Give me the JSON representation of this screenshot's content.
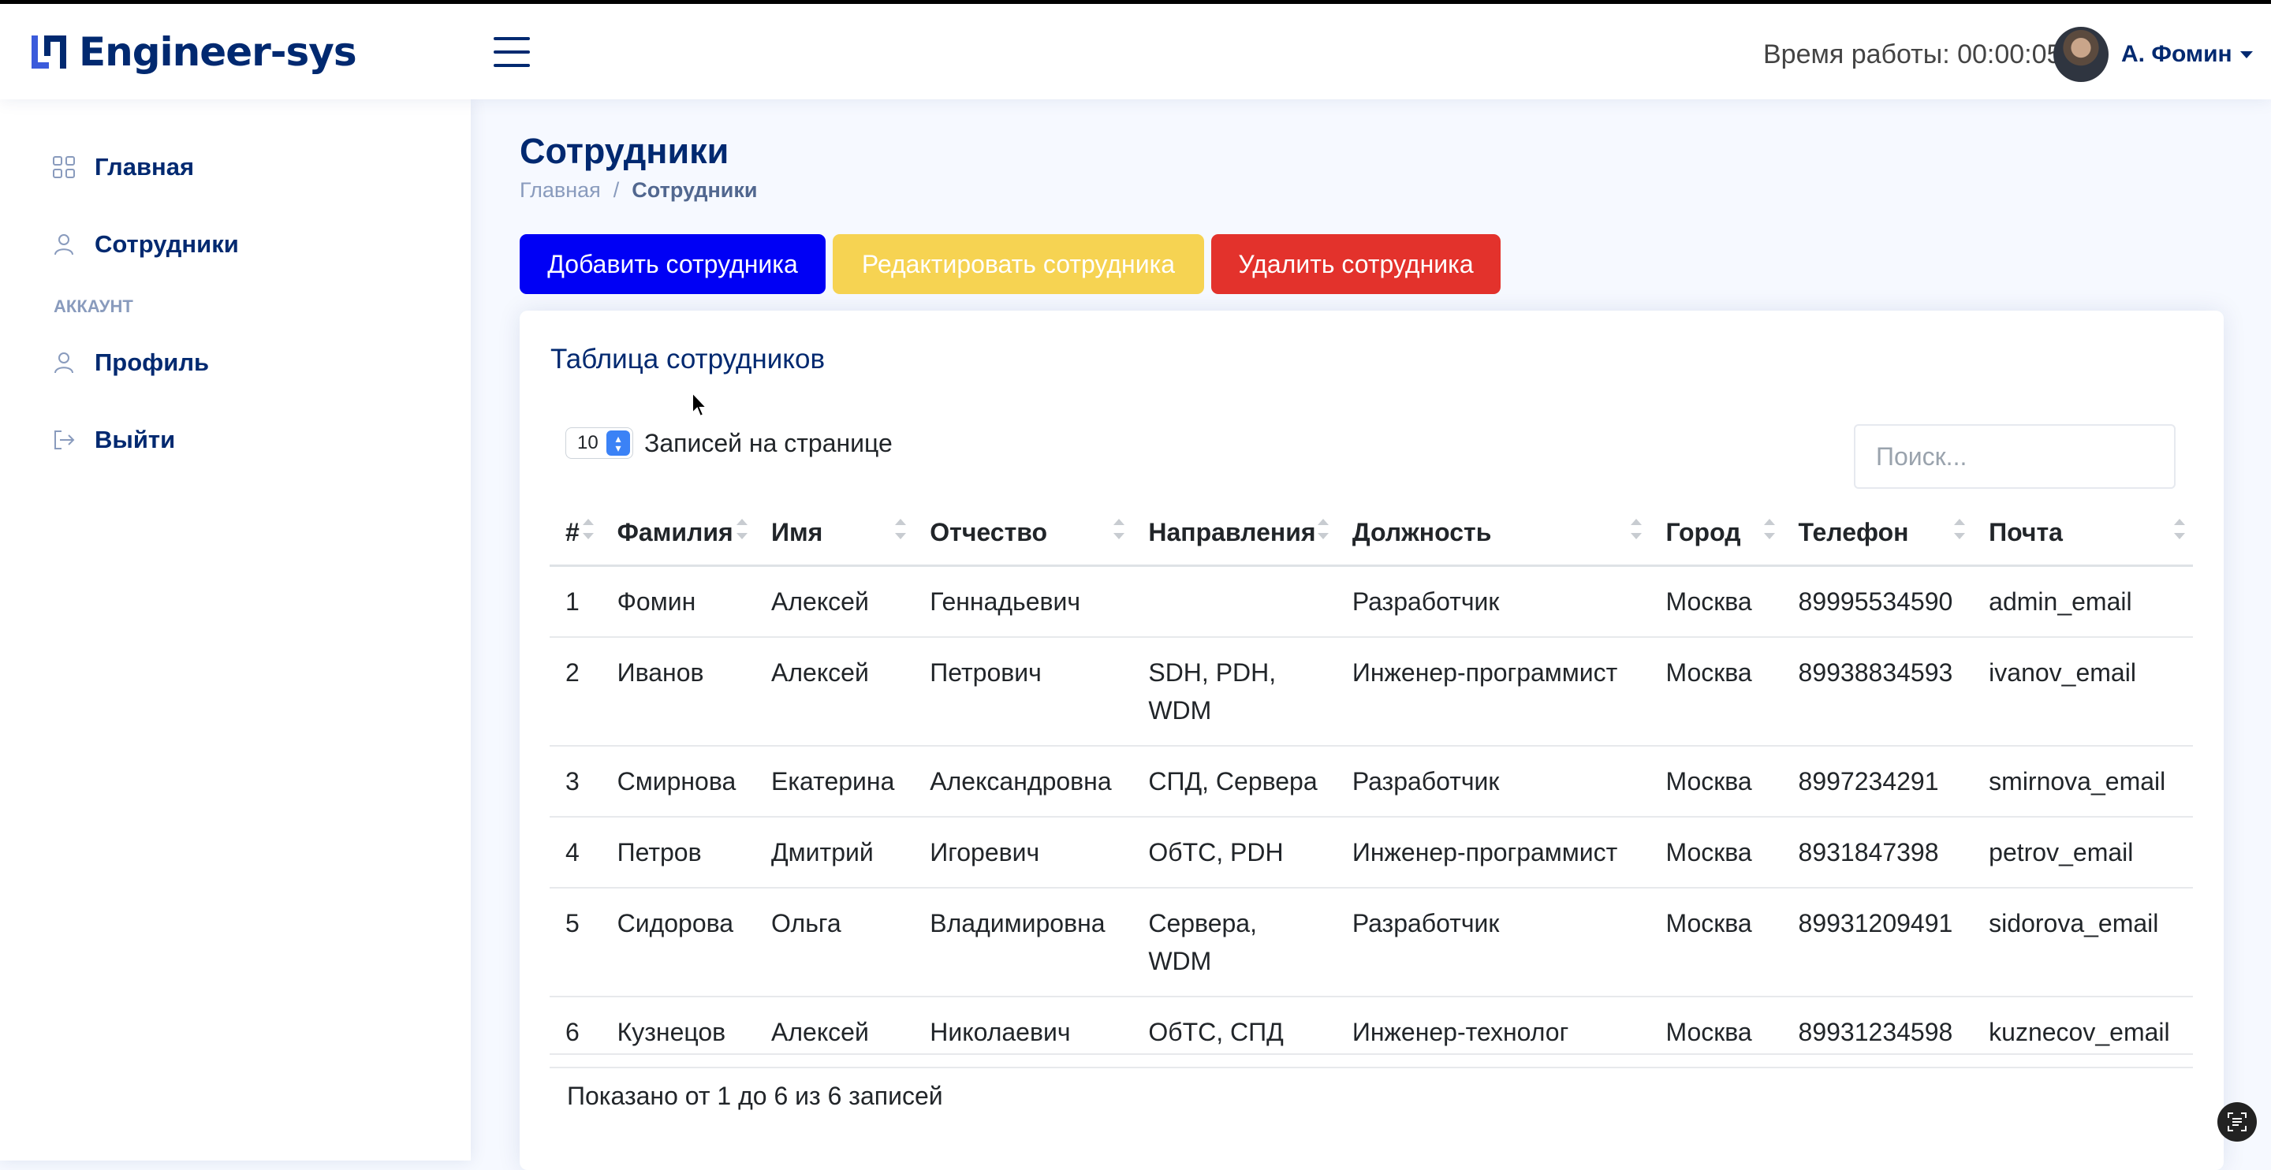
{
  "app": {
    "name": "Engineer-sys"
  },
  "header": {
    "uptime": "Время работы: 00:00:05",
    "user_name": "А. Фомин"
  },
  "sidebar": {
    "items": [
      {
        "label": "Главная",
        "icon": "grid-icon"
      },
      {
        "label": "Сотрудники",
        "icon": "person-icon"
      }
    ],
    "heading": "АККАУНТ",
    "account_items": [
      {
        "label": "Профиль",
        "icon": "person-icon"
      },
      {
        "label": "Выйти",
        "icon": "logout-icon"
      }
    ]
  },
  "page": {
    "title": "Сотрудники",
    "breadcrumb": [
      "Главная",
      "/",
      "Сотрудники"
    ]
  },
  "actions": {
    "add": "Добавить сотрудника",
    "edit": "Редактировать сотрудника",
    "delete": "Удалить сотрудника"
  },
  "card": {
    "title": "Таблица сотрудников",
    "page_length": "10",
    "page_length_label": "Записей на странице",
    "search_placeholder": "Поиск...",
    "info": "Показано от 1 до 6 из 6 записей"
  },
  "table": {
    "columns": [
      "#",
      "Фамилия",
      "Имя",
      "Отчество",
      "Направления",
      "Должность",
      "Город",
      "Телефон",
      "Почта"
    ],
    "rows": [
      [
        "1",
        "Фомин",
        "Алексей",
        "Геннадьевич",
        "",
        "Разработчик",
        "Москва",
        "89995534590",
        "admin_email"
      ],
      [
        "2",
        "Иванов",
        "Алексей",
        "Петрович",
        "SDH, PDH, WDM",
        "Инженер-программист",
        "Москва",
        "89938834593",
        "ivanov_email"
      ],
      [
        "3",
        "Смирнова",
        "Екатерина",
        "Александровна",
        "СПД, Сервера",
        "Разработчик",
        "Москва",
        "8997234291",
        "smirnova_email"
      ],
      [
        "4",
        "Петров",
        "Дмитрий",
        "Игоревич",
        "ОбТС, PDH",
        "Инженер-программист",
        "Москва",
        "8931847398",
        "petrov_email"
      ],
      [
        "5",
        "Сидорова",
        "Ольга",
        "Владимировна",
        "Сервера, WDM",
        "Разработчик",
        "Москва",
        "89931209491",
        "sidorova_email"
      ],
      [
        "6",
        "Кузнецов",
        "Алексей",
        "Николаевич",
        "ОбТС, СПД",
        "Инженер-технолог",
        "Москва",
        "89931234598",
        "kuznecov_email"
      ]
    ]
  },
  "colors": {
    "brand": "#012970",
    "add_button": "#0000f5",
    "edit_button": "#f6d352",
    "delete_button": "#e3322c"
  }
}
